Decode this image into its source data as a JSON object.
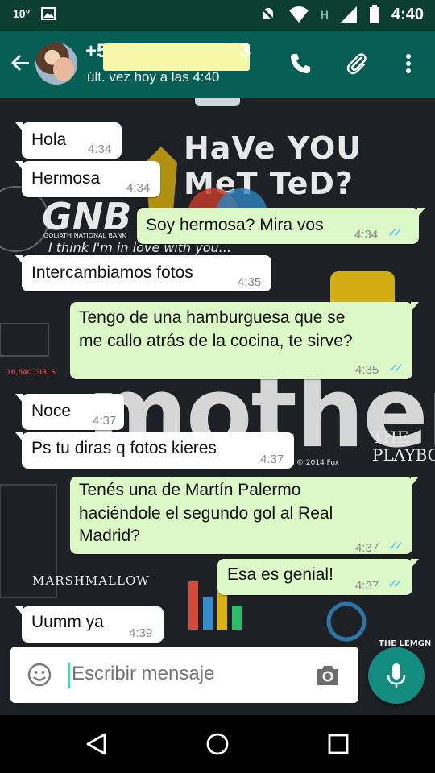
{
  "status_bar": {
    "temperature": "10°",
    "time": "4:40",
    "network_letter": "H"
  },
  "header": {
    "contact_name_prefix": "+5",
    "contact_name_suffix": "3",
    "last_seen": "últ. vez hoy a las 4:40",
    "icons": [
      "back-arrow-icon",
      "phone-icon",
      "attach-icon",
      "more-vert-icon"
    ]
  },
  "wallpaper": {
    "line1": "HaVe YOU MeT TeD?",
    "line2": "GNB",
    "line3": "GOLIATH NATIONAL BANK",
    "line4": "I think I'm in love with you...",
    "line5": "mother",
    "line6": "THE PLAYBO",
    "line7": "MARSHMALLOW",
    "line8": "THE LEMGN",
    "line9": "© 2014 Fox",
    "line10": "16,640 GIRLS"
  },
  "messages": [
    {
      "dir": "in",
      "text": "Hola",
      "time": "4:34"
    },
    {
      "dir": "in",
      "text": "Hermosa",
      "time": "4:34"
    },
    {
      "dir": "out",
      "text": "Soy hermosa? Mira vos",
      "time": "4:34"
    },
    {
      "dir": "in",
      "text": "Intercambiamos fotos",
      "time": "4:35"
    },
    {
      "dir": "out",
      "text_line1": "Tengo de una hamburguesa que se",
      "text_line2": "me callo atrás de la cocina, te sirve?",
      "time": "4:35"
    },
    {
      "dir": "in",
      "text": "Noce",
      "time": "4:37"
    },
    {
      "dir": "in",
      "text": "Ps tu diras q fotos kieres",
      "time": "4:37"
    },
    {
      "dir": "out",
      "text_line1": "Tenés una de Martín Palermo",
      "text_line2": "haciéndole el segundo gol al Real",
      "text_line3": "Madrid?",
      "time": "4:37"
    },
    {
      "dir": "out",
      "text": "Esa es genial!",
      "time": "4:37"
    },
    {
      "dir": "in",
      "text": "Uumm ya",
      "time": "4:39"
    }
  ],
  "input": {
    "placeholder": "Escribir mensaje"
  },
  "colors": {
    "header": "#075e54",
    "status": "#0b3d31",
    "outgoing": "#dcf8c6",
    "incoming": "#ffffff",
    "fab": "#128c7e",
    "read_ticks": "#4fc3f7"
  }
}
